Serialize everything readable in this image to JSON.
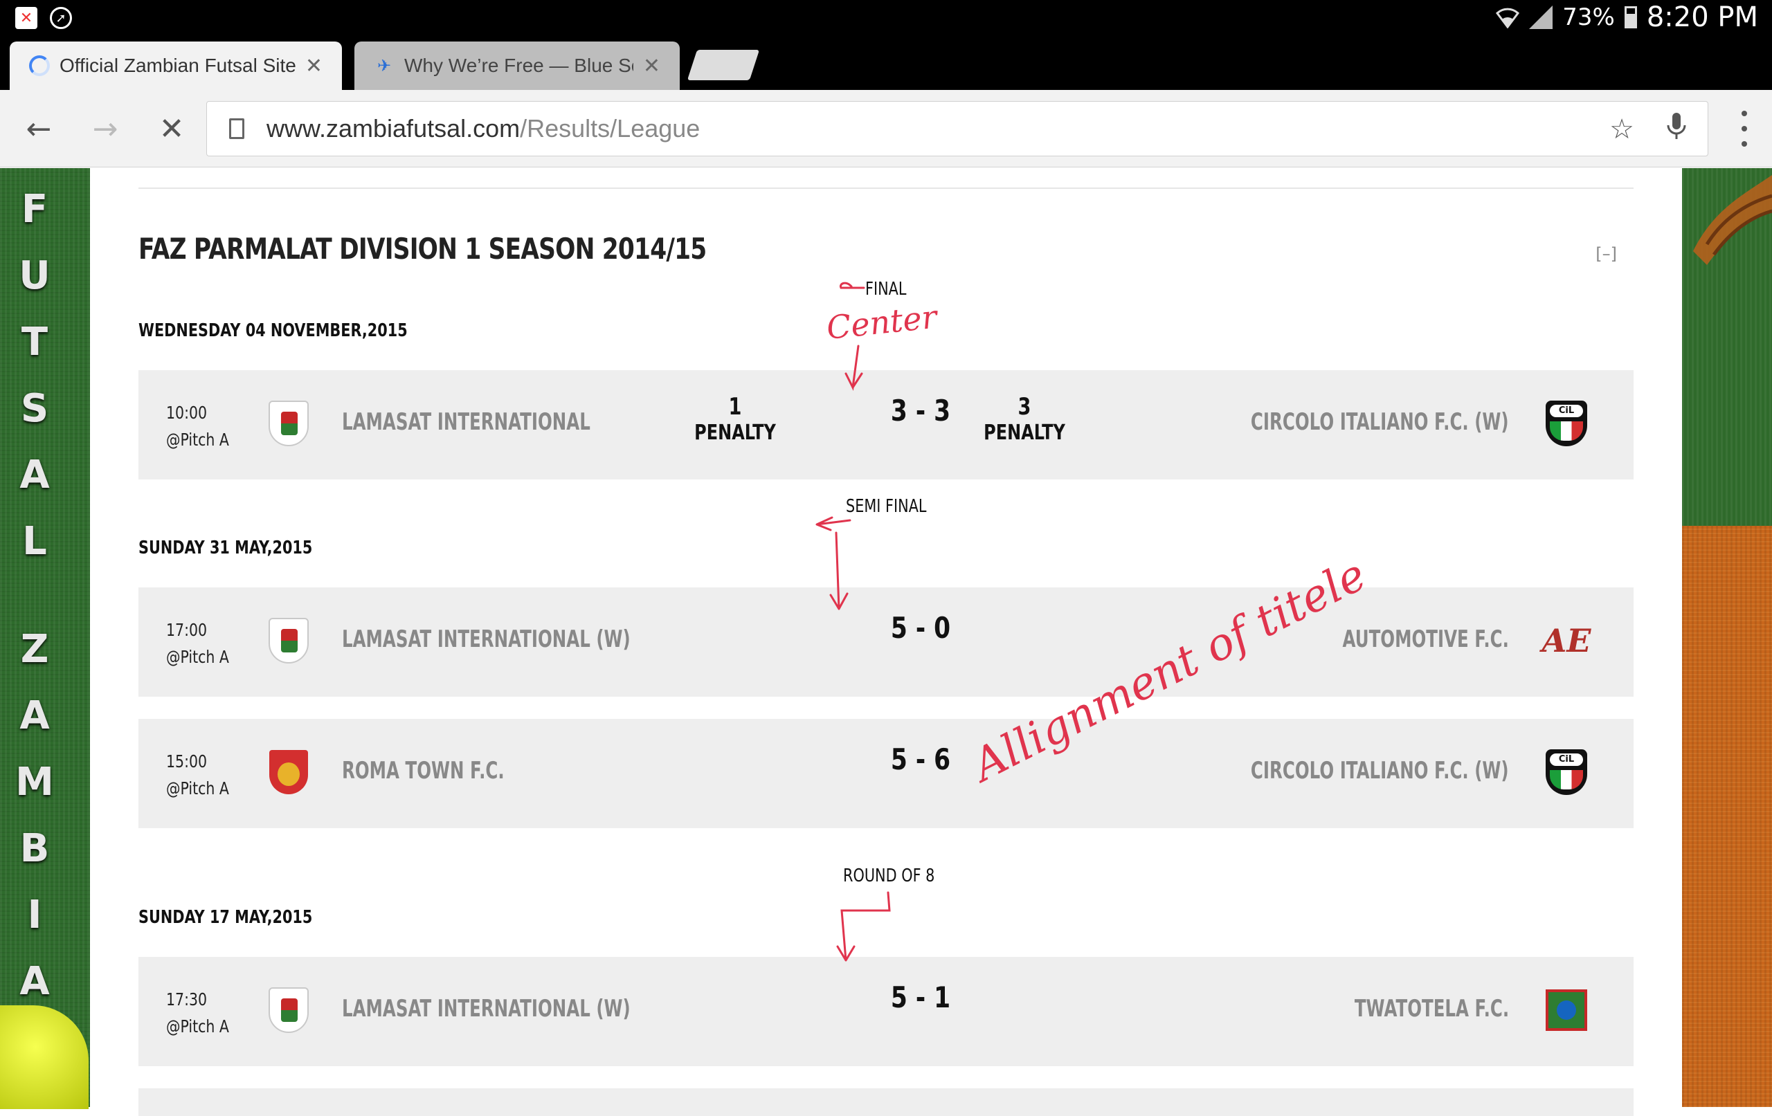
{
  "status_bar": {
    "battery": "73%",
    "time": "8:20 PM"
  },
  "tabs": [
    {
      "title": "Official Zambian Futsal Site",
      "active": true
    },
    {
      "title": "Why We’re Free — Blue Som",
      "active": false
    }
  ],
  "omnibox": {
    "host": "www.zambiafutsal.com",
    "path": "/Results/League"
  },
  "banner": {
    "left_letters": [
      "F",
      "U",
      "T",
      "S",
      "A",
      "L",
      "",
      "Z",
      "A",
      "M",
      "B",
      "I",
      "A"
    ]
  },
  "league": {
    "title": "FAZ PARMALAT DIVISION 1 SEASON 2014/15",
    "collapse_label": "[–]",
    "rounds": [
      {
        "name": "FINAL",
        "date": "WEDNESDAY 04 NOVEMBER,2015",
        "matches": [
          {
            "time": "10:00",
            "venue": "@Pitch A",
            "home": "LAMASAT INTERNATIONAL",
            "home_crest": "lamasat",
            "score": "3 - 3",
            "home_pen": "1",
            "away_pen": "3",
            "pen_label": "PENALTY",
            "away": "CIRCOLO ITALIANO F.C. (W)",
            "away_crest": "circolo"
          }
        ]
      },
      {
        "name": "SEMI FINAL",
        "date": "SUNDAY 31 MAY,2015",
        "matches": [
          {
            "time": "17:00",
            "venue": "@Pitch A",
            "home": "LAMASAT INTERNATIONAL (W)",
            "home_crest": "lamasat",
            "score": "5 - 0",
            "away": "AUTOMOTIVE F.C.",
            "away_crest": "automotive"
          },
          {
            "time": "15:00",
            "venue": "@Pitch A",
            "home": "ROMA TOWN F.C.",
            "home_crest": "roma",
            "score": "5 - 6",
            "away": "CIRCOLO ITALIANO F.C. (W)",
            "away_crest": "circolo"
          }
        ]
      },
      {
        "name": "ROUND OF 8",
        "date": "SUNDAY 17 MAY,2015",
        "matches": [
          {
            "time": "17:30",
            "venue": "@Pitch A",
            "home": "LAMASAT INTERNATIONAL (W)",
            "home_crest": "lamasat",
            "score": "5 - 1",
            "away": "TWATOTELA F.C.",
            "away_crest": "twatotela"
          }
        ]
      }
    ]
  },
  "annotations": {
    "center_note": "Center",
    "alignment_note": "Allignment of titele"
  },
  "colors": {
    "row_bg": "#eeeeee",
    "team_text": "#888888",
    "annotation": "#e0344d"
  }
}
